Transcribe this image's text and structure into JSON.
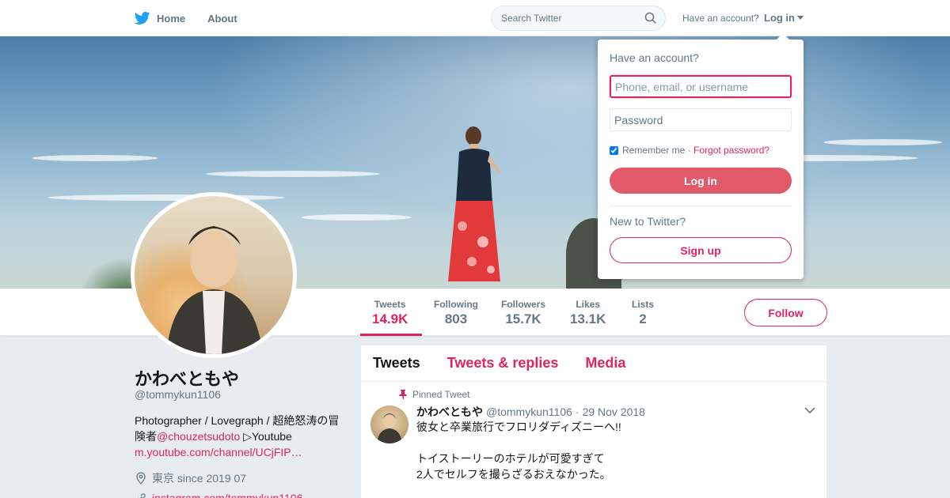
{
  "nav": {
    "home_label": "Home",
    "about_label": "About",
    "search_placeholder": "Search Twitter",
    "have_account": "Have an account?",
    "login_label": "Log in"
  },
  "colors": {
    "accent": "#e0245e",
    "login_button": "#e2596a",
    "brand_blue": "#1da1f2"
  },
  "profile": {
    "name": "かわべともや",
    "handle": "@tommykun1106",
    "bio_text_1": "Photographer / Lovegraph / 超絶怒涛の冒険者",
    "bio_mention": "@chouzetsudoto",
    "bio_text_2": " ▷Youtube ",
    "bio_link": "m.youtube.com/channel/UCjFIP…",
    "location": "東京 since 2019 07",
    "website": "instagram.com/tommykun1106"
  },
  "stats": [
    {
      "label": "Tweets",
      "value": "14.9K"
    },
    {
      "label": "Following",
      "value": "803"
    },
    {
      "label": "Followers",
      "value": "15.7K"
    },
    {
      "label": "Likes",
      "value": "13.1K"
    },
    {
      "label": "Lists",
      "value": "2"
    }
  ],
  "follow_label": "Follow",
  "timeline": {
    "tabs": [
      "Tweets",
      "Tweets & replies",
      "Media"
    ],
    "pinned_label": "Pinned Tweet",
    "tweet": {
      "name": "かわべともや",
      "handle": "@tommykun1106",
      "date": "29 Nov 2018",
      "text": "彼女と卒業旅行でフロリダディズニーへ!!\n\nトイストーリーのホテルが可愛すぎて\n2人でセルフを撮らざるおえなかった。"
    }
  },
  "login_dropdown": {
    "title": "Have an account?",
    "username_placeholder": "Phone, email, or username",
    "password_placeholder": "Password",
    "remember_label": "Remember me",
    "separator": " · ",
    "forgot_label": "Forgot password?",
    "login_button": "Log in",
    "new_label": "New to Twitter?",
    "signup_button": "Sign up"
  },
  "icons": [
    "twitter-bird-icon",
    "search-icon",
    "caret-down-icon",
    "pin-icon",
    "location-icon",
    "link-icon",
    "chevron-down-icon"
  ]
}
